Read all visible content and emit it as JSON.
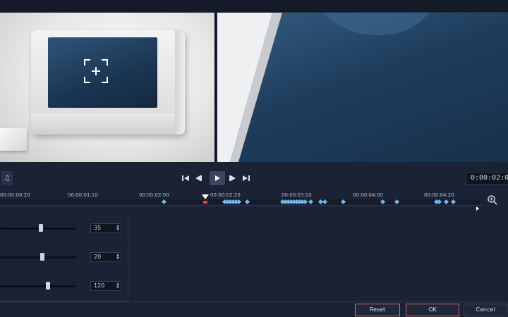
{
  "transport": {
    "left_icon": "audio-mix-icon",
    "buttons": [
      {
        "name": "go-to-start-button",
        "glyph": "⏮"
      },
      {
        "name": "previous-frame-button",
        "glyph": "◀"
      },
      {
        "name": "play-button",
        "glyph": "▶"
      },
      {
        "name": "next-frame-button",
        "glyph": "▶"
      },
      {
        "name": "go-to-end-button",
        "glyph": "⏭"
      }
    ],
    "timecode": "0:00:02:019"
  },
  "timeline": {
    "ticks": [
      "00:00:00:20",
      "00:00:01:10",
      "00:00:02:00",
      "00:00:02:20",
      "00:00:03:10",
      "00:00:04:00",
      "00:00:04:20"
    ],
    "zoom_icon": "zoom-in-icon"
  },
  "settings": {
    "rows": [
      {
        "value": "35",
        "level": 0.54
      },
      {
        "value": "20",
        "level": 0.56
      },
      {
        "value": "120",
        "level": 0.63
      }
    ]
  },
  "buttons": {
    "reset": "Reset",
    "ok": "OK",
    "cancel": "Cancel"
  },
  "colors": {
    "background": "#1b2233",
    "keyframe": "#6fb6e8",
    "playhead_marker": "#e04b2b",
    "button_highlight": "#e06a5f"
  }
}
